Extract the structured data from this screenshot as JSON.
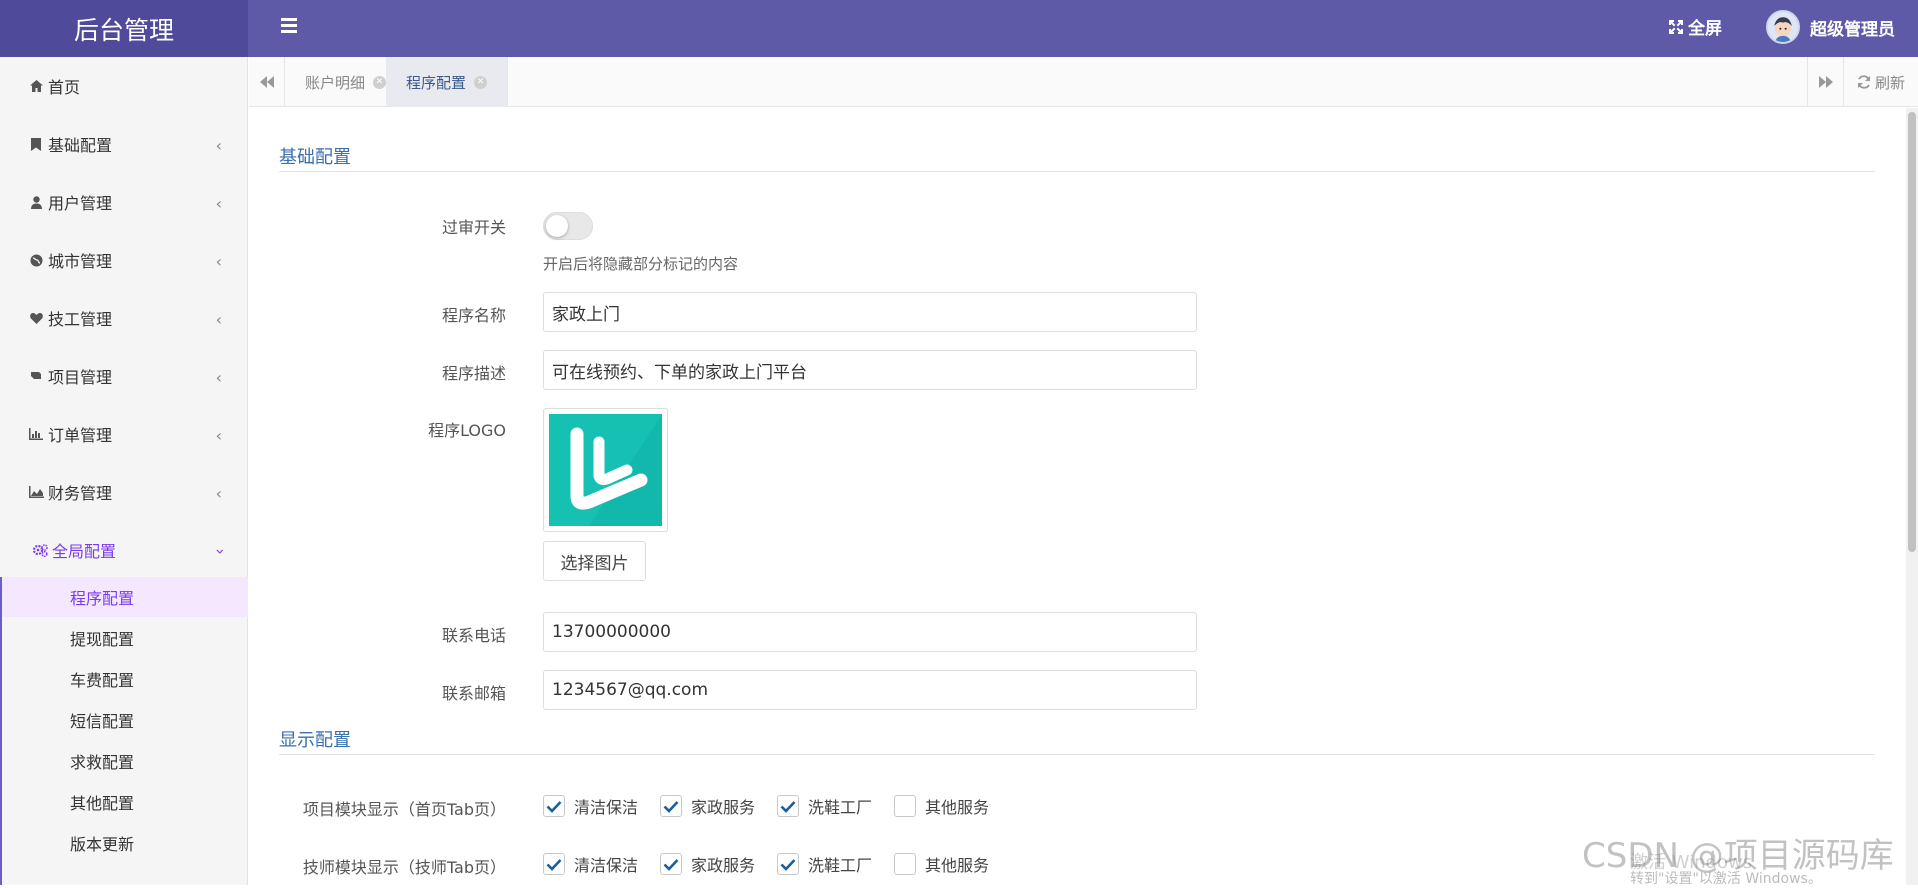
{
  "header": {
    "title": "后台管理",
    "fullscreen_label": "全屏",
    "user_name": "超级管理员",
    "bg_color": "#5f5aa8"
  },
  "sidebar": {
    "items": [
      {
        "label": "首页",
        "icon": "home-icon"
      },
      {
        "label": "基础配置",
        "icon": "bookmark-icon"
      },
      {
        "label": "用户管理",
        "icon": "user-icon"
      },
      {
        "label": "城市管理",
        "icon": "globe-icon"
      },
      {
        "label": "技工管理",
        "icon": "heart-icon"
      },
      {
        "label": "项目管理",
        "icon": "hand-icon"
      },
      {
        "label": "订单管理",
        "icon": "bar-chart-icon"
      },
      {
        "label": "财务管理",
        "icon": "area-chart-icon"
      },
      {
        "label": "全局配置",
        "icon": "gears-icon"
      }
    ],
    "sub_items": [
      "程序配置",
      "提现配置",
      "车费配置",
      "短信配置",
      "求救配置",
      "其他配置",
      "版本更新"
    ],
    "active_sub": "程序配置",
    "accent_color": "#7c3aed"
  },
  "tabs": {
    "items": [
      {
        "label": "账户明细",
        "active": false
      },
      {
        "label": "程序配置",
        "active": true
      }
    ],
    "refresh_label": "刷新"
  },
  "form": {
    "section_basic": "基础配置",
    "review_switch_label": "过审开关",
    "review_switch_on": false,
    "review_switch_help": "开启后将隐藏部分标记的内容",
    "app_name_label": "程序名称",
    "app_name_value": "家政上门",
    "app_desc_label": "程序描述",
    "app_desc_value": "可在线预约、下单的家政上门平台",
    "logo_label": "程序LOGO",
    "choose_image_label": "选择图片",
    "phone_label": "联系电话",
    "phone_value": "13700000000",
    "email_label": "联系邮箱",
    "email_value": "1234567@qq.com",
    "section_display": "显示配置",
    "project_module_label": "项目模块显示（首页Tab页）",
    "tech_module_label": "技师模块显示（技师Tab页）",
    "module_options": [
      {
        "label": "清洁保洁",
        "checked": true
      },
      {
        "label": "家政服务",
        "checked": true
      },
      {
        "label": "洗鞋工厂",
        "checked": true
      },
      {
        "label": "其他服务",
        "checked": false
      }
    ]
  },
  "watermark": {
    "csdn": "CSDN @项目源码库",
    "win_activate": "激活 Windows",
    "win_hint": "转到\"设置\"以激活 Windows。"
  }
}
